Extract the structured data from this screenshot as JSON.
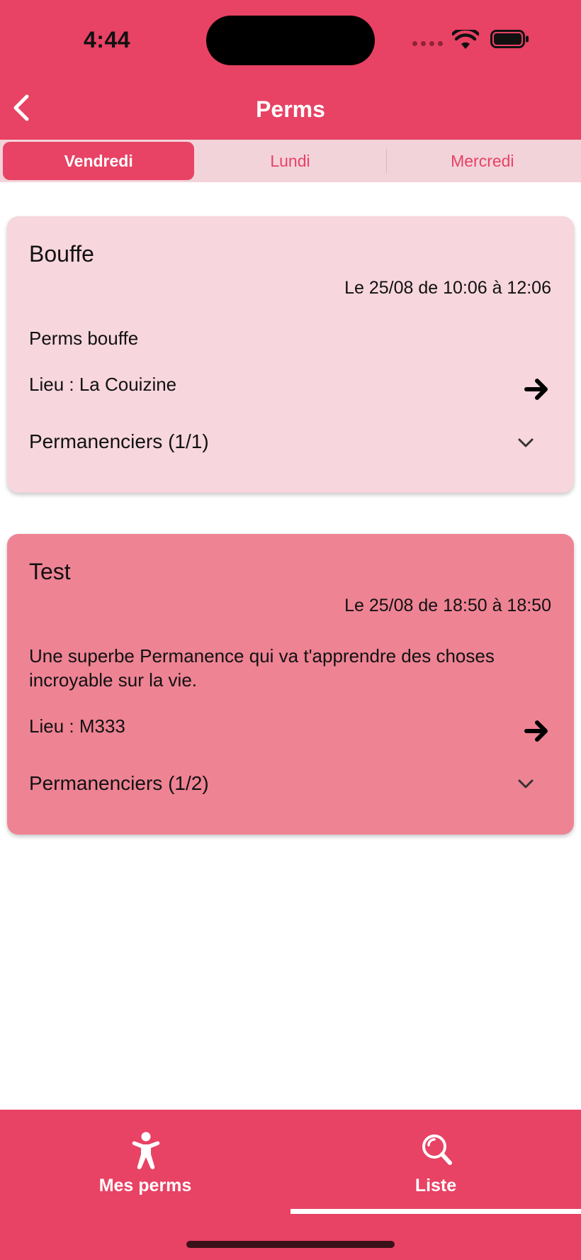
{
  "status_bar": {
    "time": "4:44"
  },
  "app_bar": {
    "title": "Perms"
  },
  "tabs": [
    {
      "label": "Vendredi",
      "active": true
    },
    {
      "label": "Lundi",
      "active": false
    },
    {
      "label": "Mercredi",
      "active": false
    }
  ],
  "cards": [
    {
      "title": "Bouffe",
      "time": "Le 25/08 de 10:06 à 12:06",
      "description": "Perms bouffe",
      "location": "Lieu : La Couizine",
      "permanenciers": "Permanenciers (1/1)",
      "color": "#f7d6dd"
    },
    {
      "title": "Test",
      "time": "Le 25/08 de 18:50 à 18:50",
      "description": "Une superbe Permanence qui va t'apprendre des choses incroyable sur la vie.",
      "location": "Lieu : M333",
      "permanenciers": "Permanenciers (1/2)",
      "color": "#ee8394"
    }
  ],
  "bottom_nav": {
    "items": [
      {
        "label": "Mes perms",
        "icon": "accessibility-person-icon",
        "selected": false
      },
      {
        "label": "Liste",
        "icon": "search-icon",
        "selected": true
      }
    ]
  },
  "colors": {
    "primary": "#e84264",
    "tab_bar_bg": "#f2d3da",
    "card_light": "#f7d6dd",
    "card_medium": "#ee8394"
  }
}
